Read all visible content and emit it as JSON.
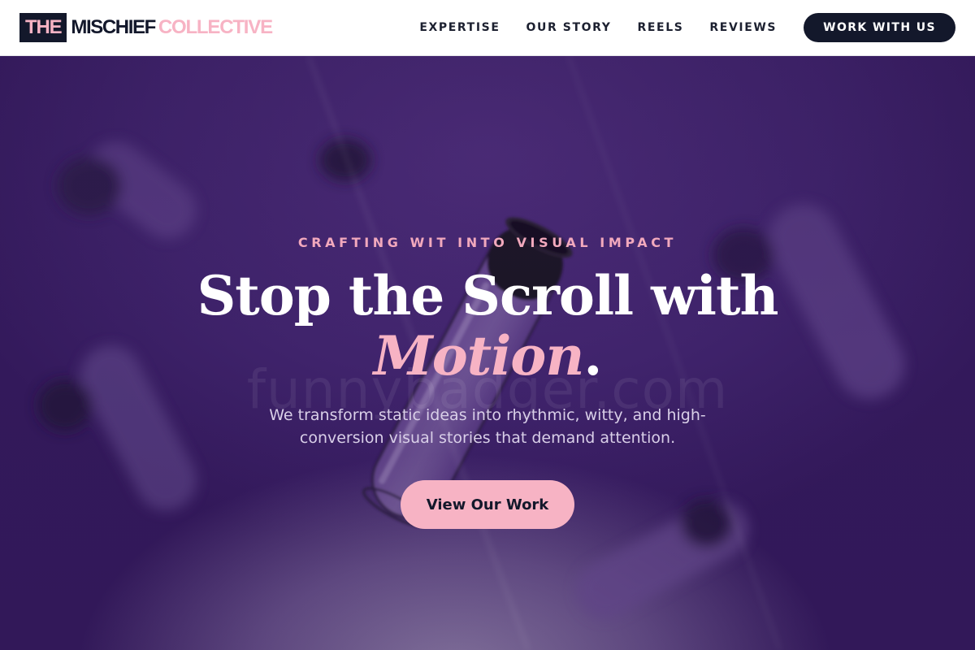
{
  "brand": {
    "the": "THE",
    "mischief": "MISCHIEF",
    "collective": "COLLECTIVE"
  },
  "nav": {
    "items": [
      "EXPERTISE",
      "OUR STORY",
      "REELS",
      "REVIEWS"
    ],
    "cta": "WORK WITH US"
  },
  "hero": {
    "eyebrow": "CRAFTING WIT INTO VISUAL IMPACT",
    "headline_line1": "Stop the Scroll with",
    "headline_accent": "Motion",
    "headline_period": ".",
    "subtitle": "We transform static ideas into rhythmic, witty, and high-conversion visual stories that demand attention.",
    "button": "View Our Work",
    "watermark": "funnybadger.com"
  },
  "colors": {
    "navy": "#13182b",
    "pink": "#f7b3c4",
    "purple": "#3f236b"
  }
}
